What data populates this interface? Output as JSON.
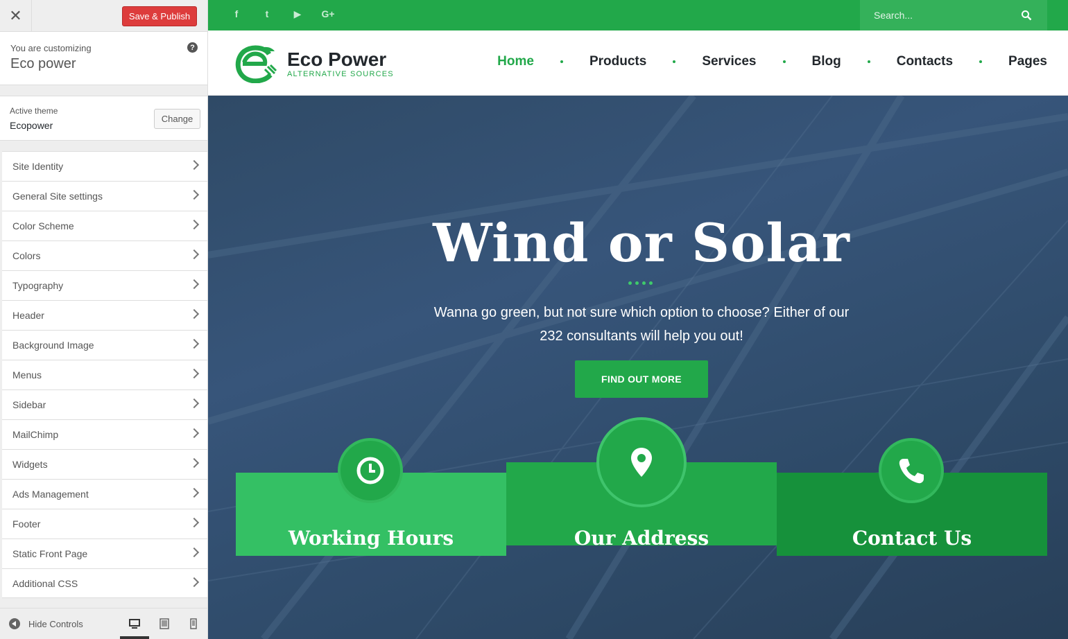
{
  "customizer": {
    "close_icon": "close-icon",
    "save_label": "Save & Publish",
    "customizing_label": "You are customizing",
    "site_name": "Eco power",
    "help_glyph": "?",
    "active_theme_label": "Active theme",
    "active_theme_name": "Ecopower",
    "change_label": "Change",
    "sections": [
      {
        "label": "Site Identity"
      },
      {
        "label": "General Site settings"
      },
      {
        "label": "Color Scheme"
      },
      {
        "label": "Colors"
      },
      {
        "label": "Typography"
      },
      {
        "label": "Header"
      },
      {
        "label": "Background Image"
      },
      {
        "label": "Menus"
      },
      {
        "label": "Sidebar"
      },
      {
        "label": "MailChimp"
      },
      {
        "label": "Widgets"
      },
      {
        "label": "Ads Management"
      },
      {
        "label": "Footer"
      },
      {
        "label": "Static Front Page"
      },
      {
        "label": "Additional CSS"
      }
    ],
    "hide_controls_label": "Hide Controls",
    "device_preview": [
      "desktop-icon",
      "tablet-icon",
      "mobile-icon"
    ],
    "active_device": "desktop"
  },
  "site": {
    "social_icons": [
      {
        "name": "facebook-icon",
        "glyph": "f"
      },
      {
        "name": "twitter-icon",
        "glyph": "t"
      },
      {
        "name": "youtube-icon",
        "glyph": "▶"
      },
      {
        "name": "google-plus-icon",
        "glyph": "G+"
      }
    ],
    "search_placeholder": "Search...",
    "logo_title": "Eco Power",
    "logo_subtitle": "ALTERNATIVE SOURCES",
    "nav": [
      "Home",
      "Products",
      "Services",
      "Blog",
      "Contacts",
      "Pages"
    ],
    "nav_active": "Home",
    "hero": {
      "title": "Wind or Solar",
      "text": "Wanna go green, but not sure which option to choose? Either of our 232 consultants will help you out!",
      "button": "FIND OUT MORE"
    },
    "cards": [
      {
        "title": "Working Hours",
        "icon": "clock-icon"
      },
      {
        "title": "Our Address",
        "icon": "map-pin-icon"
      },
      {
        "title": "Contact Us",
        "icon": "phone-icon"
      }
    ]
  },
  "colors": {
    "accent": "#22a84a",
    "save_button": "#dd3c3c",
    "hero_overlay": "#2f4a66"
  }
}
